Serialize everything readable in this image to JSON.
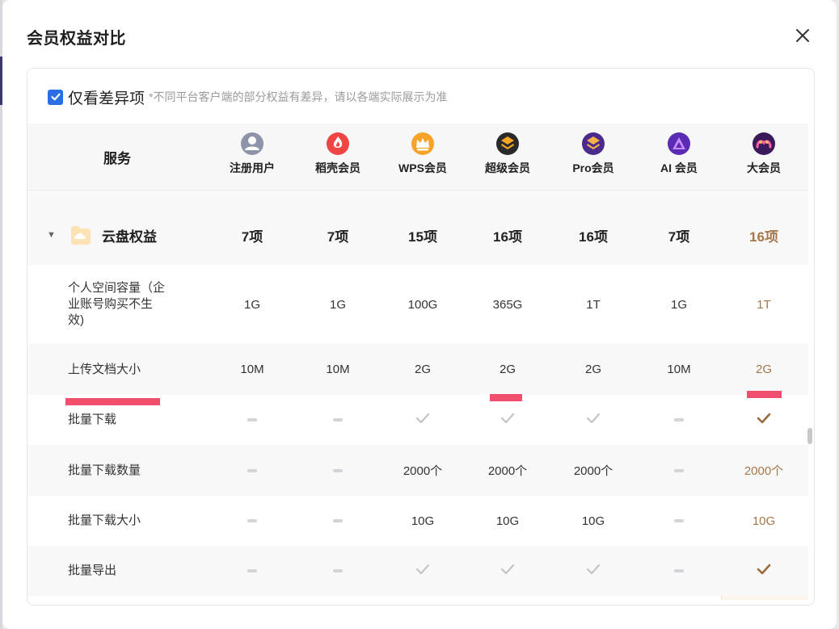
{
  "dialog": {
    "title": "会员权益对比"
  },
  "filter": {
    "checked": true,
    "label": "仅看差异项",
    "note": "*不同平台客户端的部分权益有差异，请以各端实际展示为准"
  },
  "table": {
    "service_header": "服务",
    "plans": [
      {
        "name": "注册用户",
        "icon": "user-avatar-icon",
        "color": "#8e93a8"
      },
      {
        "name": "稻壳会员",
        "icon": "docer-flame-icon",
        "color": "#f04545"
      },
      {
        "name": "WPS会员",
        "icon": "crown-icon",
        "color": "#f7a32a"
      },
      {
        "name": "超级会员",
        "icon": "super-layers-icon",
        "color": "#2a2a2a"
      },
      {
        "name": "Pro会员",
        "icon": "pro-layers-icon",
        "color": "#4a2a8a"
      },
      {
        "name": "AI 会员",
        "icon": "ai-triangle-icon",
        "color": "#5a2bb5"
      },
      {
        "name": "大会员",
        "icon": "big-member-icon",
        "color": "#3a1a5a"
      }
    ],
    "group": {
      "label": "云盘权益",
      "icon": "cloud-folder-icon",
      "counts": [
        "7项",
        "7项",
        "15项",
        "16项",
        "16项",
        "7项",
        "16项"
      ]
    },
    "rows": [
      {
        "label_lines": [
          "个人空间容量（企",
          "业账号购买不生",
          "效)"
        ],
        "values": [
          "1G",
          "1G",
          "100G",
          "365G",
          "1T",
          "1G",
          "1T"
        ]
      },
      {
        "label_lines": [
          "上传文档大小"
        ],
        "values": [
          "10M",
          "10M",
          "2G",
          "2G",
          "2G",
          "10M",
          "2G"
        ]
      },
      {
        "label_lines": [
          "批量下载"
        ],
        "values": [
          "-",
          "-",
          "✓",
          "✓",
          "✓",
          "-",
          "✓"
        ]
      },
      {
        "label_lines": [
          "批量下载数量"
        ],
        "values": [
          "-",
          "-",
          "2000个",
          "2000个",
          "2000个",
          "-",
          "2000个"
        ]
      },
      {
        "label_lines": [
          "批量下载大小"
        ],
        "values": [
          "-",
          "-",
          "10G",
          "10G",
          "10G",
          "-",
          "10G"
        ]
      },
      {
        "label_lines": [
          "批量导出"
        ],
        "values": [
          "-",
          "-",
          "✓",
          "✓",
          "✓",
          "-",
          "✓"
        ]
      }
    ]
  },
  "colors": {
    "accent_blue": "#2b6de5",
    "highlight_text": "#a5774a",
    "highlight_bg": "#fdf4ea",
    "annotation_red": "#f0506e"
  }
}
